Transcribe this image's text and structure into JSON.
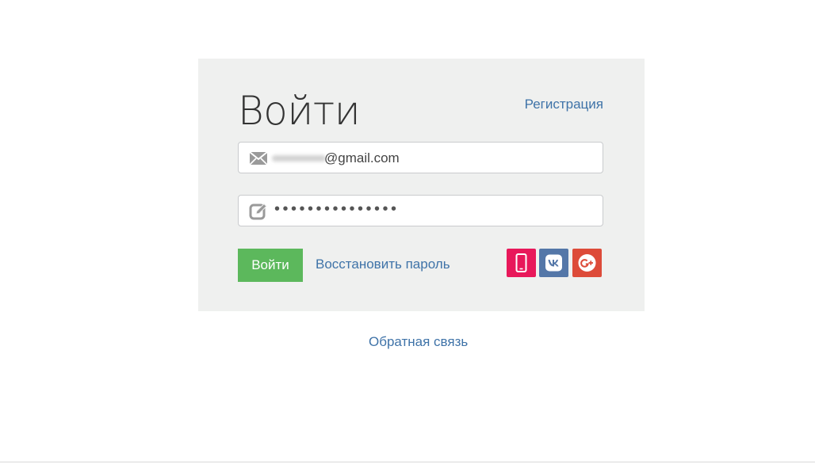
{
  "login_form": {
    "title": "Войти",
    "register_link": "Регистрация",
    "email": {
      "icon": "envelope-icon",
      "value": "@gmail.com"
    },
    "password": {
      "icon": "edit-pencil-icon",
      "value": "•••••••••••••••"
    },
    "submit_label": "Войти",
    "restore_link": "Восстановить пароль",
    "social_buttons": [
      {
        "name": "phone",
        "icon": "mobile-phone-icon",
        "color": "#e8185a"
      },
      {
        "name": "vk",
        "icon": "vk-icon",
        "color": "#5477a8"
      },
      {
        "name": "google-plus",
        "icon": "google-plus-icon",
        "color": "#dd4b39"
      }
    ],
    "background": "#eff0ef",
    "submit_color": "#5cb85c",
    "link_color": "#3f73a8"
  },
  "footer": {
    "feedback_link": "Обратная связь"
  }
}
